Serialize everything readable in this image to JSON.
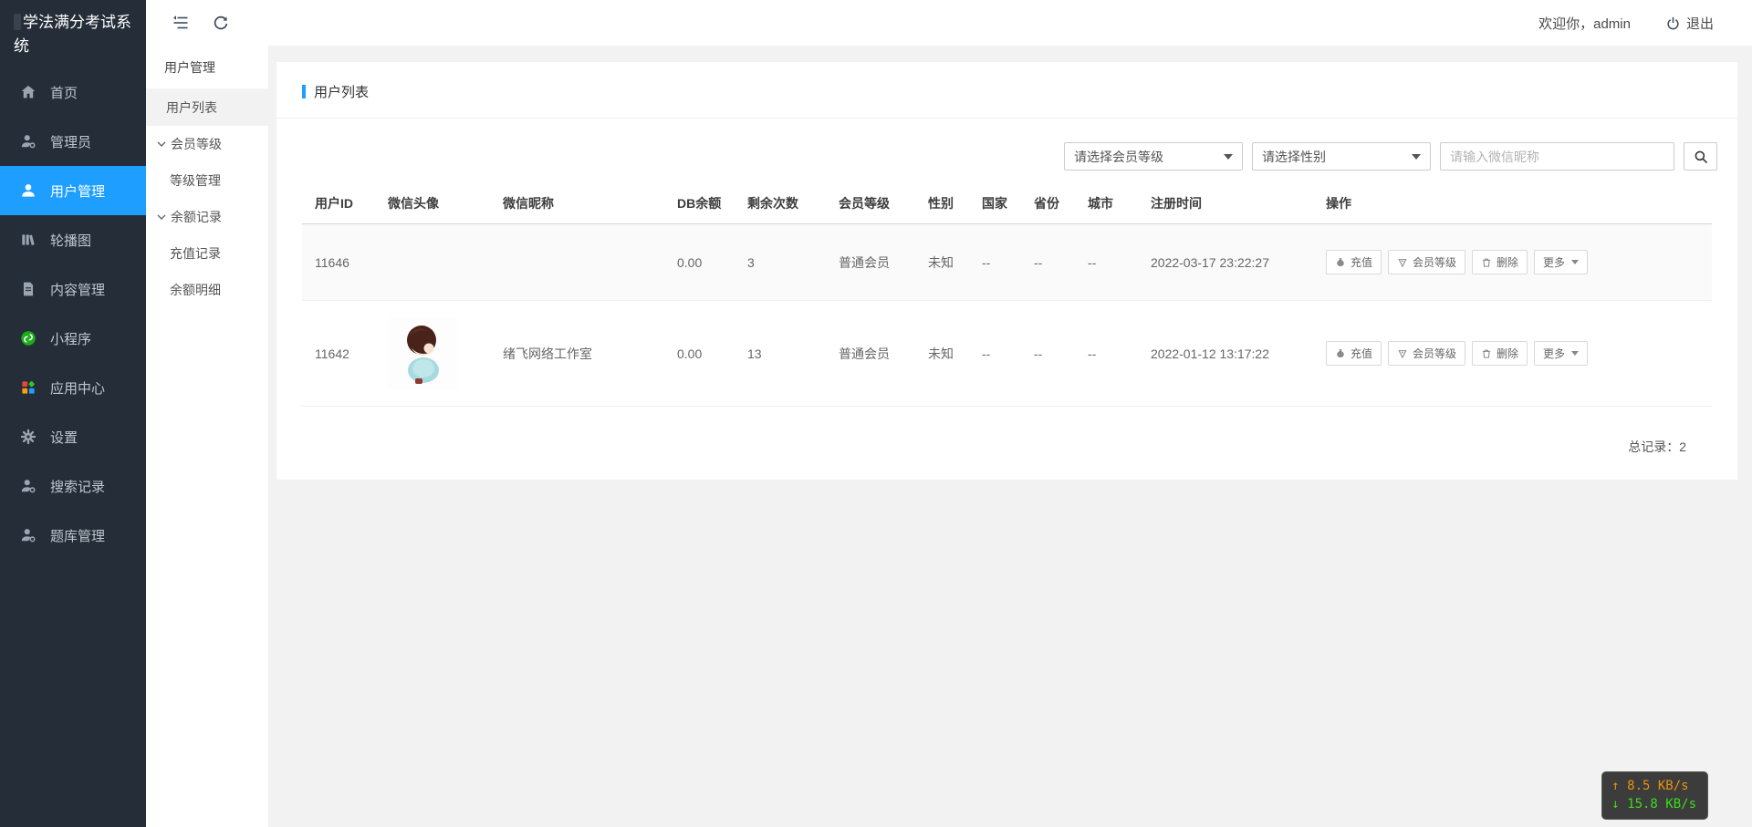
{
  "app": {
    "title": "学法满分考试系统",
    "welcome": "欢迎你，admin",
    "logout_label": "退出"
  },
  "sidebar": {
    "items": [
      {
        "icon": "home-icon",
        "label": "首页"
      },
      {
        "icon": "admin-user-icon",
        "label": "管理员"
      },
      {
        "icon": "user-icon",
        "label": "用户管理",
        "active": true
      },
      {
        "icon": "carousel-icon",
        "label": "轮播图"
      },
      {
        "icon": "content-icon",
        "label": "内容管理"
      },
      {
        "icon": "miniprogram-icon",
        "label": "小程序"
      },
      {
        "icon": "app-center-icon",
        "label": "应用中心"
      },
      {
        "icon": "gear-icon",
        "label": "设置"
      },
      {
        "icon": "search-record-icon",
        "label": "搜索记录"
      },
      {
        "icon": "question-bank-icon",
        "label": "题库管理"
      }
    ]
  },
  "submenu": {
    "header": "用户管理",
    "items": [
      {
        "label": "用户列表",
        "type": "item",
        "active": true
      },
      {
        "label": "会员等级",
        "type": "parent"
      },
      {
        "label": "等级管理",
        "type": "child"
      },
      {
        "label": "余额记录",
        "type": "parent"
      },
      {
        "label": "充值记录",
        "type": "child"
      },
      {
        "label": "余额明细",
        "type": "child"
      }
    ]
  },
  "page": {
    "title": "用户列表",
    "total_label": "总记录：",
    "total_value": "2"
  },
  "filters": {
    "level_select": "请选择会员等级",
    "gender_select": "请选择性别",
    "search_placeholder": "请输入微信昵称"
  },
  "table": {
    "columns": [
      "用户ID",
      "微信头像",
      "微信昵称",
      "DB余额",
      "剩余次数",
      "会员等级",
      "性别",
      "国家",
      "省份",
      "城市",
      "注册时间",
      "操作"
    ],
    "actions": [
      "充值",
      "会员等级",
      "删除",
      "更多"
    ],
    "rows": [
      {
        "id": "11646",
        "nickname": "",
        "balance": "0.00",
        "remaining": "3",
        "level": "普通会员",
        "gender": "未知",
        "country": "--",
        "province": "--",
        "city": "--",
        "reg_time": "2022-03-17 23:22:27"
      },
      {
        "id": "11642",
        "nickname": "绪飞网络工作室",
        "balance": "0.00",
        "remaining": "13",
        "level": "普通会员",
        "gender": "未知",
        "country": "--",
        "province": "--",
        "city": "--",
        "reg_time": "2022-01-12 13:17:22"
      }
    ]
  },
  "netspeed": {
    "up": "↑ 8.5 KB/s",
    "down": "↓ 15.8 KB/s"
  },
  "colors": {
    "accent_blue": "#1e9fff",
    "sidebar_dark": "#252d38",
    "miniprogram_green": "#1aad19",
    "net_up": "#e8930c",
    "net_down": "#3ddc1b"
  }
}
